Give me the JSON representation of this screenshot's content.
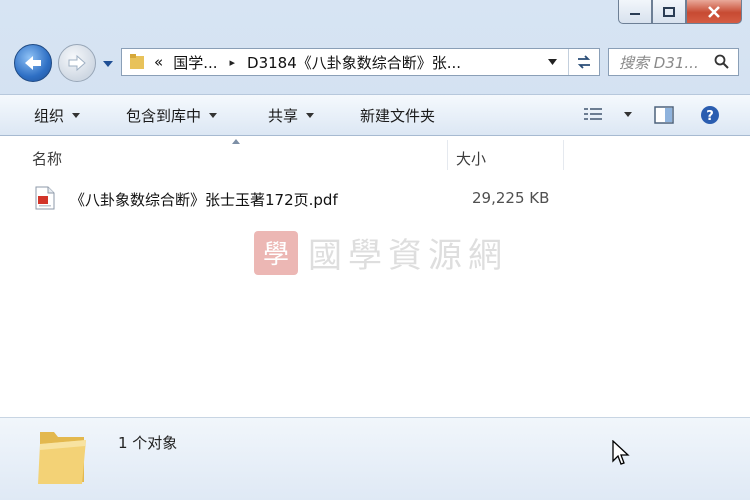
{
  "titlebar": {
    "minimize_icon": "minimize-icon",
    "maximize_icon": "maximize-icon",
    "close_icon": "close-icon"
  },
  "navigation": {
    "back_icon": "back-arrow-icon",
    "forward_icon": "forward-arrow-icon",
    "recent_icon": "chevron-down-icon"
  },
  "address": {
    "overflow": "«",
    "crumb1": "国学...",
    "separator": "▸",
    "crumb2": "D3184《八卦象数综合断》张..."
  },
  "search": {
    "placeholder": "搜索 D31..."
  },
  "toolbar": {
    "organize": "组织",
    "include_in_library": "包含到库中",
    "share": "共享",
    "new_folder": "新建文件夹"
  },
  "columns": {
    "name": "名称",
    "size": "大小"
  },
  "files": [
    {
      "name": "《八卦象数综合断》张士玉著172页.pdf",
      "size": "29,225 KB",
      "icon": "pdf-file-icon"
    }
  ],
  "watermark": {
    "seal": "學",
    "text": "國學資源網"
  },
  "details": {
    "count": "1 个对象"
  },
  "colors": {
    "frame": "#d7e4f3",
    "close_red": "#c74a32",
    "back_blue": "#2e6fc4",
    "help_blue": "#2a5db0"
  }
}
